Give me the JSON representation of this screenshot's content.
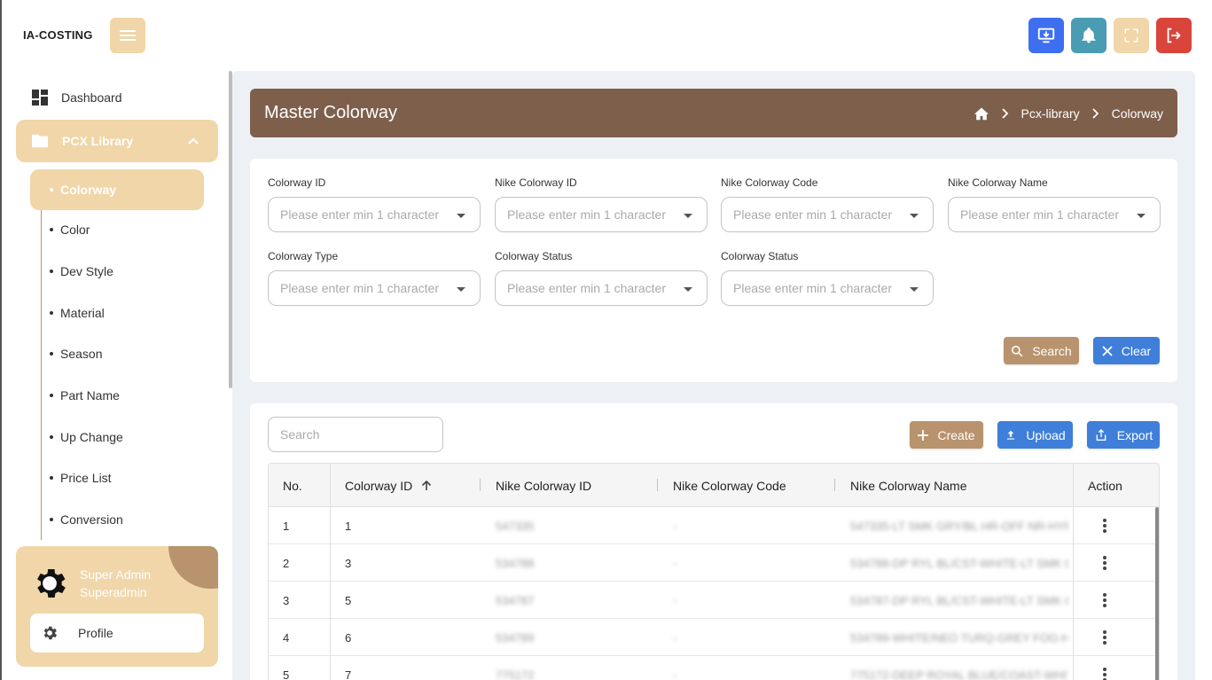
{
  "app": {
    "brand": "IA-COSTING"
  },
  "topbar": {
    "icons": [
      "menu-icon",
      "download-screen-icon",
      "bell-icon",
      "fullscreen-icon",
      "logout-icon"
    ],
    "colors": {
      "blue": "#3d6ff0",
      "teal": "#4a9cb3",
      "sand": "#f0d6a8",
      "red": "#d9453a"
    }
  },
  "sidebar": {
    "dashboard": "Dashboard",
    "group": "PCX Library",
    "items": [
      {
        "label": "Colorway",
        "active": true
      },
      {
        "label": "Color"
      },
      {
        "label": "Dev Style"
      },
      {
        "label": "Material"
      },
      {
        "label": "Season"
      },
      {
        "label": "Part Name"
      },
      {
        "label": "Up Change"
      },
      {
        "label": "Price List"
      },
      {
        "label": "Conversion"
      }
    ],
    "user": {
      "name": "Super Admin",
      "role": "Superadmin",
      "profile": "Profile"
    }
  },
  "header": {
    "title": "Master Colorway",
    "breadcrumb": [
      "Pcx-library",
      "Colorway"
    ]
  },
  "filters": {
    "placeholder": "Please enter min 1 character",
    "fields": [
      "Colorway ID",
      "Nike Colorway ID",
      "Nike Colorway Code",
      "Nike Colorway Name",
      "Colorway Type",
      "Colorway Status",
      "Colorway Status"
    ],
    "search_btn": "Search",
    "clear_btn": "Clear"
  },
  "table": {
    "search_placeholder": "Search",
    "create_btn": "Create",
    "upload_btn": "Upload",
    "export_btn": "Export",
    "columns": [
      "No.",
      "Colorway ID",
      "Nike Colorway ID",
      "Nike Colorway Code",
      "Nike Colorway Name",
      "Action"
    ],
    "sort": {
      "column": "Colorway ID",
      "direction": "asc"
    },
    "rows": [
      {
        "no": "1",
        "colorway_id": "1",
        "nike_id": "547335",
        "code": "-",
        "name": "547335-LT SMK GRY/BL HR-OFF NR-HYP"
      },
      {
        "no": "2",
        "colorway_id": "3",
        "nike_id": "534788",
        "code": "-",
        "name": "534788-DP RYL BL/CST-WHITE-LT SMK G"
      },
      {
        "no": "3",
        "colorway_id": "5",
        "nike_id": "534787",
        "code": "-",
        "name": "534787-DP RYL BL/CST-WHITE-LT SMK G"
      },
      {
        "no": "4",
        "colorway_id": "6",
        "nike_id": "534789",
        "code": "-",
        "name": "534789-WHITE/NEO TURQ-GREY FOG-H"
      },
      {
        "no": "5",
        "colorway_id": "7",
        "nike_id": "775172",
        "code": "-",
        "name": "775172-DEEP ROYAL BLUE/COAST-WHIT"
      }
    ]
  }
}
